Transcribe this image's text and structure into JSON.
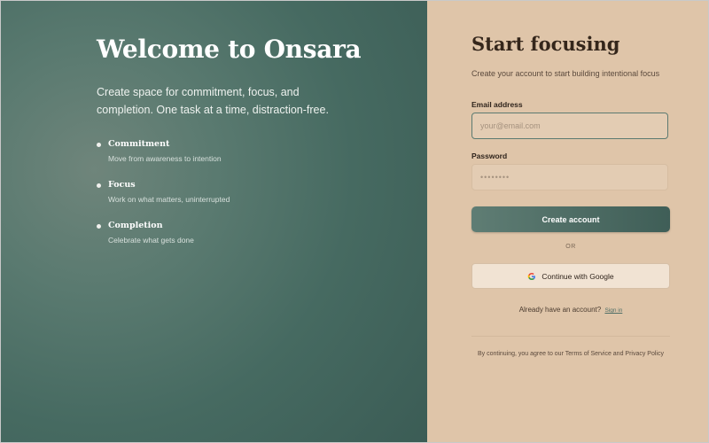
{
  "hero": {
    "title": "Welcome to Onsara",
    "tagline": "Create space for commitment, focus, and completion. One task at a time, distraction-free.",
    "pillars": [
      {
        "title": "Commitment",
        "desc": "Move from awareness to intention"
      },
      {
        "title": "Focus",
        "desc": "Work on what matters, uninterrupted"
      },
      {
        "title": "Completion",
        "desc": "Celebrate what gets done"
      }
    ]
  },
  "signup": {
    "title": "Start focusing",
    "subtitle": "Create your account to start building intentional focus",
    "email_label": "Email address",
    "email_placeholder": "your@email.com",
    "email_value": "",
    "password_label": "Password",
    "password_placeholder": "••••••••",
    "password_value": "",
    "create_button": "Create account",
    "or_text": "OR",
    "google_button": "Continue with Google",
    "google_icon": "google-icon",
    "have_account_text": "Already have an account?",
    "signin_link": "Sign in",
    "terms_text": "By continuing, you agree to our Terms of Service and Privacy Policy"
  },
  "colors": {
    "hero_bg": "#4d6f66",
    "panel_bg": "#dfc5a9",
    "accent": "#4f6e66",
    "title_text": "#34261b"
  }
}
